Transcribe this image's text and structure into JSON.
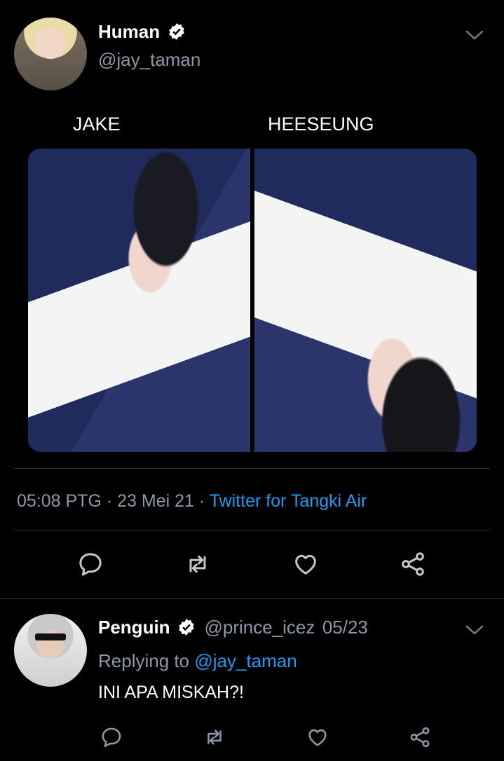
{
  "tweet": {
    "author_name": "Human",
    "author_handle": "@jay_taman",
    "caption_left": "JAKE",
    "caption_right": "HEESEUNG",
    "time": "05:08 PTG",
    "date": "23 Mei 21",
    "source": "Twitter for Tangki Air"
  },
  "reply": {
    "author_name": "Penguin",
    "author_handle": "@prince_icez",
    "date": "05/23",
    "replying_to_label": "Replying to",
    "replying_to_handle": "@jay_taman",
    "text": "INI APA MISKAH?!"
  },
  "icons": {
    "verified": "verified-badge-icon",
    "more": "chevron-down-icon",
    "reply": "comment-icon",
    "retweet": "retweet-icon",
    "like": "heart-icon",
    "share": "share-icon"
  },
  "colors": {
    "background": "#000000",
    "accent": "#1d9bf0",
    "secondary_text": "#8b98a5",
    "divider": "#2f3336"
  }
}
